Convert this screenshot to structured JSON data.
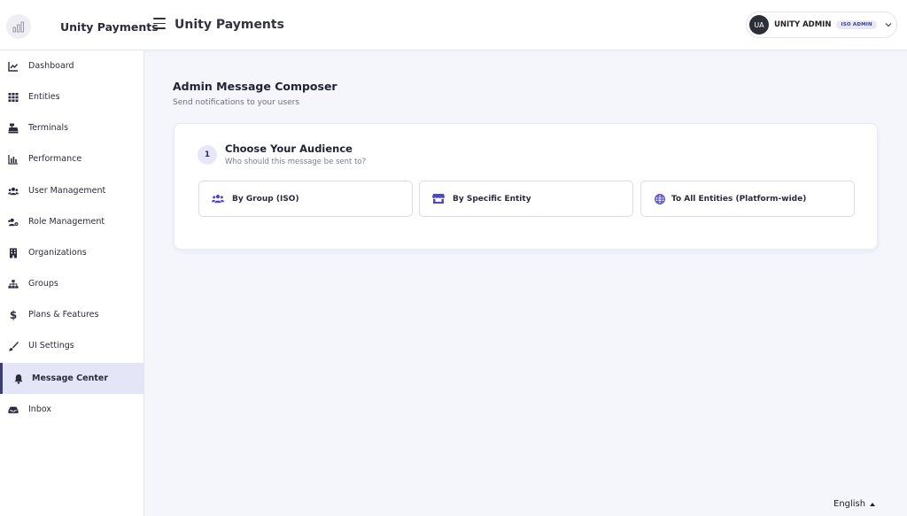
{
  "header": {
    "brand_name": "Unity Payments",
    "title": "Unity Payments",
    "logo_icon": "bar-chart-logo-icon",
    "user": {
      "initials": "UA",
      "name": "UNITY ADMIN",
      "role_badge": "ISO ADMIN"
    }
  },
  "sidebar": {
    "items": [
      {
        "label": "Dashboard",
        "icon": "chart-line-icon",
        "active": false
      },
      {
        "label": "Entities",
        "icon": "grid-icon",
        "active": false
      },
      {
        "label": "Terminals",
        "icon": "cash-register-icon",
        "active": false
      },
      {
        "label": "Performance",
        "icon": "bar-chart-icon",
        "active": false
      },
      {
        "label": "User Management",
        "icon": "users-icon",
        "active": false
      },
      {
        "label": "Role Management",
        "icon": "users-cog-icon",
        "active": false
      },
      {
        "label": "Organizations",
        "icon": "building-icon",
        "active": false
      },
      {
        "label": "Groups",
        "icon": "sitemap-icon",
        "active": false
      },
      {
        "label": "Plans & Features",
        "icon": "dollar-icon",
        "active": false
      },
      {
        "label": "UI Settings",
        "icon": "brush-icon",
        "active": false
      },
      {
        "label": "Message Center",
        "icon": "bell-icon",
        "active": true
      },
      {
        "label": "Inbox",
        "icon": "inbox-icon",
        "active": false
      }
    ]
  },
  "main": {
    "title": "Admin Message Composer",
    "subtitle": "Send notifications to your users",
    "step": {
      "number": "1",
      "title": "Choose Your Audience",
      "subtitle": "Who should this message be sent to?",
      "options": [
        {
          "label": "By Group (ISO)",
          "icon": "users-icon"
        },
        {
          "label": "By Specific Entity",
          "icon": "store-icon"
        },
        {
          "label": "To All Entities (Platform-wide)",
          "icon": "globe-icon"
        }
      ]
    }
  },
  "footer": {
    "language": "English"
  },
  "colors": {
    "accent": "#4f46c8",
    "active_bg": "#e5e5f8",
    "page_bg": "#f5f5fc"
  }
}
